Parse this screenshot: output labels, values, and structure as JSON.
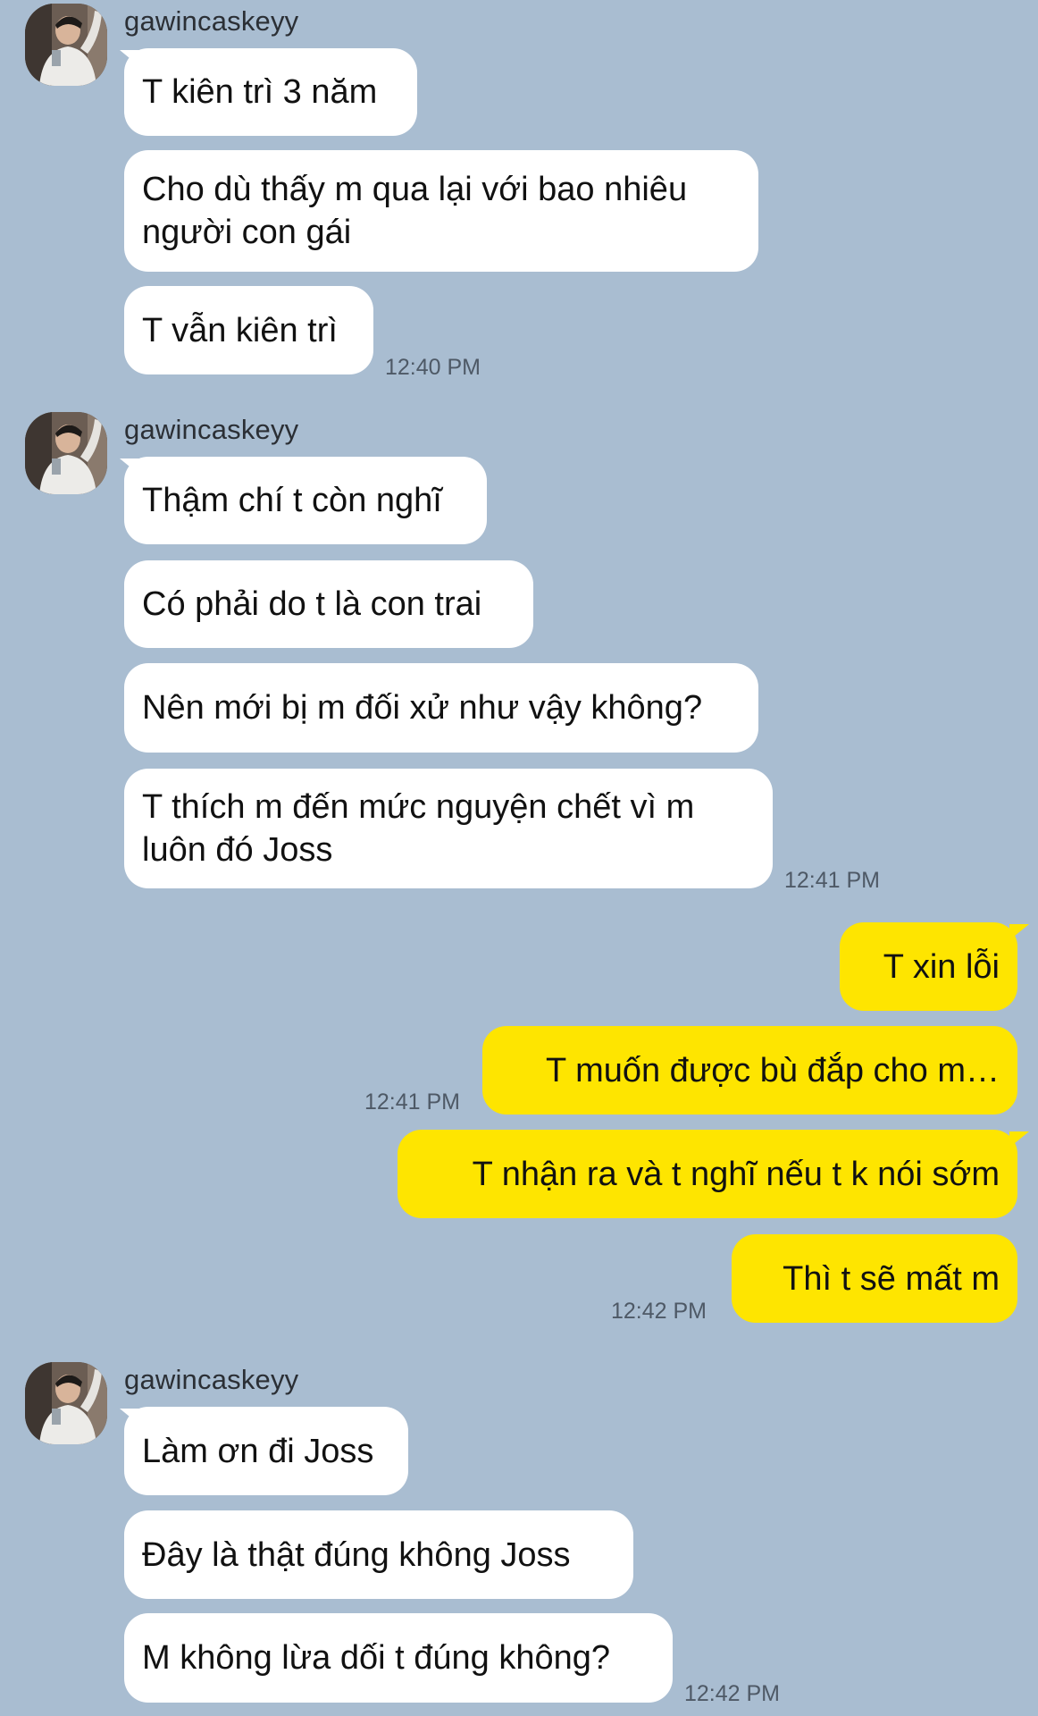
{
  "sender": "gawincaskeyy",
  "avatar_icon": "user-avatar-photo",
  "colors": {
    "background": "#a9bdd1",
    "incoming_bubble": "#ffffff",
    "outgoing_bubble": "#fee500"
  },
  "groups": [
    {
      "sender": "gawincaskeyy",
      "messages": [
        "T kiên trì 3 năm",
        "Cho dù thấy m qua lại với bao nhiêu\nngười con gái",
        "T vẫn kiên trì"
      ],
      "time": "12:40 PM"
    },
    {
      "sender": "gawincaskeyy",
      "messages": [
        "Thậm chí t còn nghĩ",
        "Có phải do t là con trai",
        "Nên mới bị m đối xử như vậy không?",
        "T thích m đến mức nguyện chết vì m\nluôn đó Joss"
      ],
      "time": "12:41 PM"
    },
    {
      "sender": "me",
      "messages": [
        "T xin lỗi",
        "T muốn được bù đắp cho m…"
      ],
      "time": "12:41 PM"
    },
    {
      "sender": "me",
      "messages": [
        "T nhận ra và t nghĩ nếu t k nói sớm",
        "Thì t sẽ mất m"
      ],
      "time": "12:42 PM"
    },
    {
      "sender": "gawincaskeyy",
      "messages": [
        "Làm ơn đi Joss",
        "Đây là thật đúng không Joss",
        "M không lừa dối t đúng không?"
      ],
      "time": "12:42 PM"
    }
  ]
}
